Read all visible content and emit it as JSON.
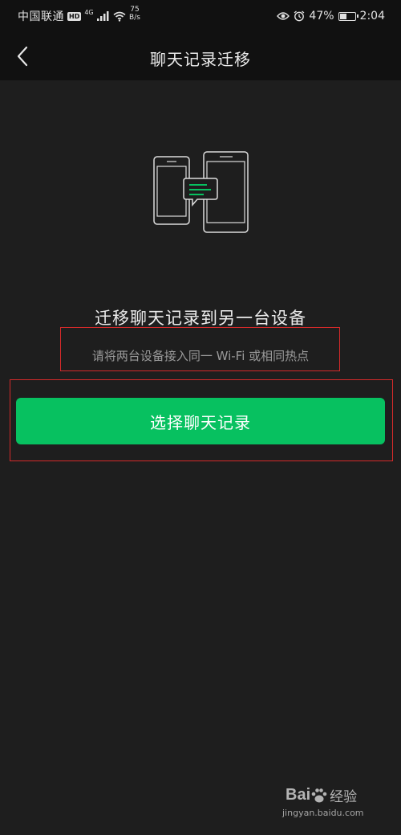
{
  "status_bar": {
    "carrier": "中国联通",
    "hd": "HD",
    "network": "4G",
    "speed_value": "75",
    "speed_unit": "B/s",
    "battery_percent": "47%",
    "battery_level": 0.47,
    "time": "2:04"
  },
  "nav": {
    "back_icon": "chevron-left-icon",
    "title": "聊天记录迁移"
  },
  "illustration": {
    "icon": "phone-to-tablet-transfer-icon",
    "accent_color": "#07c160"
  },
  "content": {
    "heading": "迁移聊天记录到另一台设备",
    "hint": "请将两台设备接入同一 Wi-Fi 或相同热点",
    "button_label": "选择聊天记录"
  },
  "watermark": {
    "logo_text": "Bai",
    "logo_suffix": "经验",
    "url": "jingyan.baidu.com"
  },
  "colors": {
    "background": "#1e1e1e",
    "bar": "#111111",
    "primary": "#07c160",
    "annotation": "#d42a2a"
  }
}
